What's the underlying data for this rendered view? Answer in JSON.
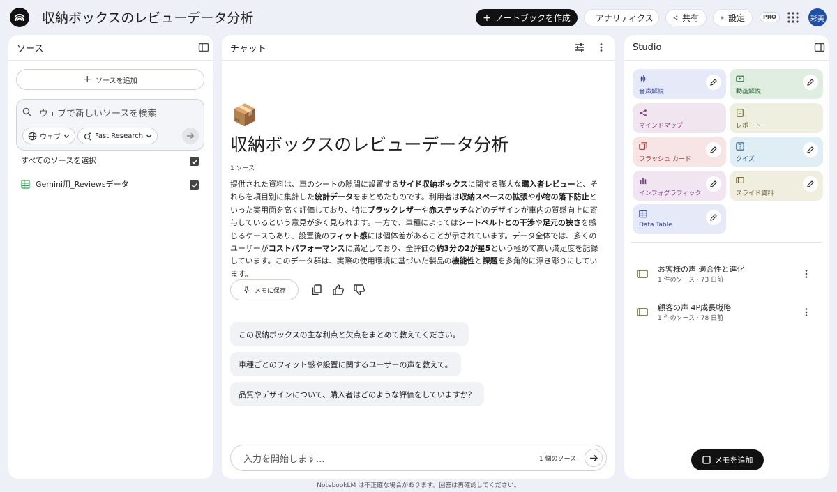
{
  "header": {
    "title": "収納ボックスのレビューデータ分析",
    "create_notebook": "ノートブックを作成",
    "analytics": "アナリティクス",
    "share": "共有",
    "settings": "設定",
    "pro": "PRO",
    "avatar": "彩美"
  },
  "sources": {
    "title": "ソース",
    "add_source": "ソースを追加",
    "search_placeholder": "ウェブで新しいソースを検索",
    "chip_web": "ウェブ",
    "chip_research": "Fast Research",
    "select_all": "すべてのソースを選択",
    "items": [
      {
        "label": "Gemini用_Reviewsデータ",
        "checked": true
      }
    ]
  },
  "chat": {
    "title": "チャット",
    "emoji": "📦",
    "heading": "収納ボックスのレビューデータ分析",
    "source_count": "1 ソース",
    "summary_segments": [
      {
        "t": "提供された資料は、車のシートの隙間に設置する"
      },
      {
        "t": "サイド収納ボックス",
        "b": true
      },
      {
        "t": "に関する膨大な"
      },
      {
        "t": "購入者レビュー",
        "b": true
      },
      {
        "t": "と、それらを項目別に集計した"
      },
      {
        "t": "統計データ",
        "b": true
      },
      {
        "t": "をまとめたものです。利用者は"
      },
      {
        "t": "収納スペースの拡張",
        "b": true
      },
      {
        "t": "や"
      },
      {
        "t": "小物の落下防止",
        "b": true
      },
      {
        "t": "といった実用面を高く評価しており、特に"
      },
      {
        "t": "ブラックレザー",
        "b": true
      },
      {
        "t": "や"
      },
      {
        "t": "赤ステッチ",
        "b": true
      },
      {
        "t": "などのデザインが車内の質感向上に寄与しているという意見が多く見られます。一方で、車種によっては"
      },
      {
        "t": "シートベルトとの干渉",
        "b": true
      },
      {
        "t": "や"
      },
      {
        "t": "足元の狭さ",
        "b": true
      },
      {
        "t": "を感じるケースもあり、設置後の"
      },
      {
        "t": "フィット感",
        "b": true
      },
      {
        "t": "には個体差があることが示されています。データ全体では、多くのユーザーが"
      },
      {
        "t": "コストパフォーマンス",
        "b": true
      },
      {
        "t": "に満足しており、全評価の"
      },
      {
        "t": "約3分の2が星5",
        "b": true
      },
      {
        "t": "という極めて高い満足度を記録しています。このデータ群は、実際の使用環境に基づいた製品の"
      },
      {
        "t": "機能性",
        "b": true
      },
      {
        "t": "と"
      },
      {
        "t": "課題",
        "b": true
      },
      {
        "t": "を多角的に浮き彫りにしています。"
      }
    ],
    "save_memo": "メモに保存",
    "suggestions": [
      "この収納ボックスの主な利点と欠点をまとめて教えてください。",
      "車種ごとのフィット感や設置に関するユーザーの声を教えて。",
      "品質やデザインについて、購入者はどのような評価をしていますか？"
    ],
    "input_placeholder": "入力を開始します...",
    "input_source_count": "1 個のソース"
  },
  "studio": {
    "title": "Studio",
    "tiles": [
      {
        "label": "音声解説",
        "icon": "audio-wave-icon",
        "color": "#e6e9f7",
        "text": "#3b4a9c"
      },
      {
        "label": "動画解説",
        "icon": "video-icon",
        "color": "#dfeee0",
        "text": "#2d6b3a"
      },
      {
        "label": "マインドマップ",
        "icon": "mindmap-icon",
        "color": "#f1e6ef",
        "text": "#8a3b7c"
      },
      {
        "label": "レポート",
        "icon": "report-icon",
        "color": "#efefe0",
        "text": "#6b6b2d"
      },
      {
        "label": "フラッシュ カード",
        "icon": "flashcard-icon",
        "color": "#f7e4e4",
        "text": "#a03a3a"
      },
      {
        "label": "クイズ",
        "icon": "quiz-icon",
        "color": "#dfedf5",
        "text": "#2b5f80"
      },
      {
        "label": "インフォグラフィック",
        "icon": "infographic-icon",
        "color": "#f0e5f1",
        "text": "#7d3b8a"
      },
      {
        "label": "スライド資料",
        "icon": "slides-icon",
        "color": "#f0eedf",
        "text": "#6b5d2d"
      },
      {
        "label": "Data Table",
        "icon": "table-icon",
        "color": "#e6e9f7",
        "text": "#2b3f8a"
      }
    ],
    "notes": [
      {
        "title": "お客様の声 適合性と進化",
        "meta": "1 件のソース · 73 日前"
      },
      {
        "title": "顧客の声 4P成長戦略",
        "meta": "1 件のソース · 78 日前"
      }
    ],
    "add_memo": "メモを追加"
  },
  "footer": "NotebookLM は不正確な場合があります。回答は再確認してください。"
}
